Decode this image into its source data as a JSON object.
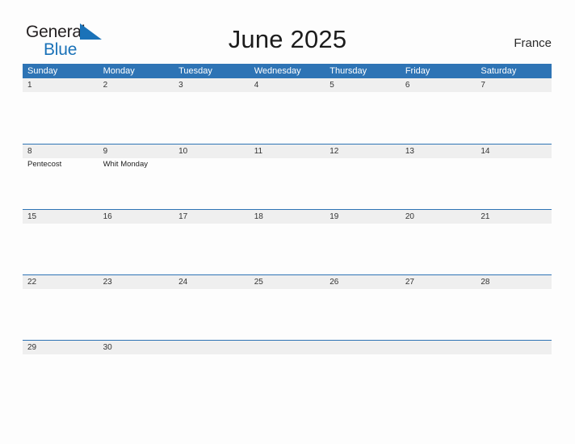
{
  "brand": {
    "name_part1": "General",
    "name_part2": "Blue",
    "mark_icon": "blue-triangle-flag-icon",
    "color_dark": "#231f20",
    "color_blue": "#1a72b8"
  },
  "header": {
    "title": "June 2025",
    "region": "France"
  },
  "theme": {
    "accent_blue": "#2e74b5",
    "band_gray": "#efefef",
    "page_background": "#fdfdfd",
    "header_text": "#ffffff",
    "date_text": "#333333"
  },
  "calendar": {
    "month": "June",
    "year": "2025",
    "weekday_headers": [
      "Sunday",
      "Monday",
      "Tuesday",
      "Wednesday",
      "Thursday",
      "Friday",
      "Saturday"
    ],
    "weeks": [
      {
        "days": [
          {
            "date": "1",
            "events": []
          },
          {
            "date": "2",
            "events": []
          },
          {
            "date": "3",
            "events": []
          },
          {
            "date": "4",
            "events": []
          },
          {
            "date": "5",
            "events": []
          },
          {
            "date": "6",
            "events": []
          },
          {
            "date": "7",
            "events": []
          }
        ]
      },
      {
        "days": [
          {
            "date": "8",
            "events": [
              "Pentecost"
            ]
          },
          {
            "date": "9",
            "events": [
              "Whit Monday"
            ]
          },
          {
            "date": "10",
            "events": []
          },
          {
            "date": "11",
            "events": []
          },
          {
            "date": "12",
            "events": []
          },
          {
            "date": "13",
            "events": []
          },
          {
            "date": "14",
            "events": []
          }
        ]
      },
      {
        "days": [
          {
            "date": "15",
            "events": []
          },
          {
            "date": "16",
            "events": []
          },
          {
            "date": "17",
            "events": []
          },
          {
            "date": "18",
            "events": []
          },
          {
            "date": "19",
            "events": []
          },
          {
            "date": "20",
            "events": []
          },
          {
            "date": "21",
            "events": []
          }
        ]
      },
      {
        "days": [
          {
            "date": "22",
            "events": []
          },
          {
            "date": "23",
            "events": []
          },
          {
            "date": "24",
            "events": []
          },
          {
            "date": "25",
            "events": []
          },
          {
            "date": "26",
            "events": []
          },
          {
            "date": "27",
            "events": []
          },
          {
            "date": "28",
            "events": []
          }
        ]
      },
      {
        "days": [
          {
            "date": "29",
            "events": []
          },
          {
            "date": "30",
            "events": []
          },
          {
            "date": "",
            "events": []
          },
          {
            "date": "",
            "events": []
          },
          {
            "date": "",
            "events": []
          },
          {
            "date": "",
            "events": []
          },
          {
            "date": "",
            "events": []
          }
        ]
      }
    ]
  }
}
